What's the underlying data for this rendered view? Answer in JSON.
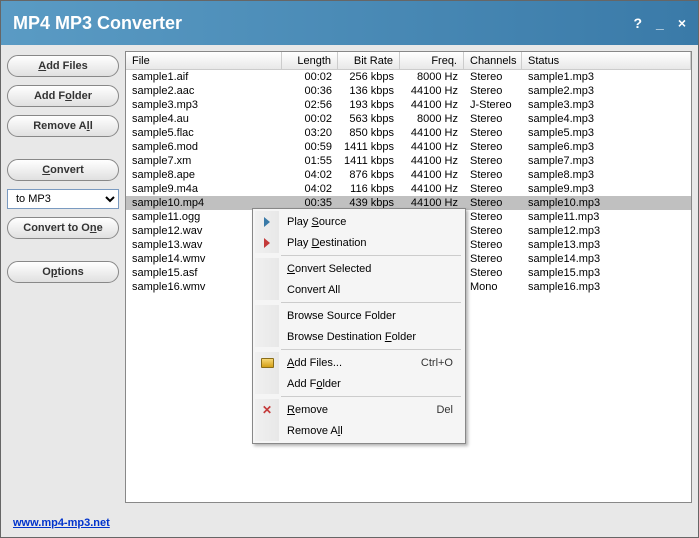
{
  "titlebar": {
    "title": "MP4 MP3 Converter"
  },
  "sidebar": {
    "add_files": "Add Files",
    "add_folder": "Add Folder",
    "remove_all": "Remove All",
    "convert": "Convert",
    "format_selected": "to MP3",
    "convert_to_one": "Convert to One",
    "options": "Options"
  },
  "grid": {
    "headers": {
      "file": "File",
      "length": "Length",
      "bitrate": "Bit Rate",
      "freq": "Freq.",
      "channels": "Channels",
      "status": "Status"
    },
    "rows": [
      {
        "file": "sample1.aif",
        "length": "00:02",
        "bitrate": "256 kbps",
        "freq": "8000 Hz",
        "channels": "Stereo",
        "status": "sample1.mp3"
      },
      {
        "file": "sample2.aac",
        "length": "00:36",
        "bitrate": "136 kbps",
        "freq": "44100 Hz",
        "channels": "Stereo",
        "status": "sample2.mp3"
      },
      {
        "file": "sample3.mp3",
        "length": "02:56",
        "bitrate": "193 kbps",
        "freq": "44100 Hz",
        "channels": "J-Stereo",
        "status": "sample3.mp3"
      },
      {
        "file": "sample4.au",
        "length": "00:02",
        "bitrate": "563 kbps",
        "freq": "8000 Hz",
        "channels": "Stereo",
        "status": "sample4.mp3"
      },
      {
        "file": "sample5.flac",
        "length": "03:20",
        "bitrate": "850 kbps",
        "freq": "44100 Hz",
        "channels": "Stereo",
        "status": "sample5.mp3"
      },
      {
        "file": "sample6.mod",
        "length": "00:59",
        "bitrate": "1411 kbps",
        "freq": "44100 Hz",
        "channels": "Stereo",
        "status": "sample6.mp3"
      },
      {
        "file": "sample7.xm",
        "length": "01:55",
        "bitrate": "1411 kbps",
        "freq": "44100 Hz",
        "channels": "Stereo",
        "status": "sample7.mp3"
      },
      {
        "file": "sample8.ape",
        "length": "04:02",
        "bitrate": "876 kbps",
        "freq": "44100 Hz",
        "channels": "Stereo",
        "status": "sample8.mp3"
      },
      {
        "file": "sample9.m4a",
        "length": "04:02",
        "bitrate": "116 kbps",
        "freq": "44100 Hz",
        "channels": "Stereo",
        "status": "sample9.mp3"
      },
      {
        "file": "sample10.mp4",
        "length": "00:35",
        "bitrate": "439 kbps",
        "freq": "44100 Hz",
        "channels": "Stereo",
        "status": "sample10.mp3",
        "selected": true
      },
      {
        "file": "sample11.ogg",
        "length": "",
        "bitrate": "",
        "freq": "",
        "channels": "Stereo",
        "status": "sample11.mp3"
      },
      {
        "file": "sample12.wav",
        "length": "",
        "bitrate": "",
        "freq": "",
        "channels": "Stereo",
        "status": "sample12.mp3"
      },
      {
        "file": "sample13.wav",
        "length": "",
        "bitrate": "",
        "freq": "",
        "channels": "Stereo",
        "status": "sample13.mp3"
      },
      {
        "file": "sample14.wmv",
        "length": "",
        "bitrate": "",
        "freq": "",
        "channels": "Stereo",
        "status": "sample14.mp3"
      },
      {
        "file": "sample15.asf",
        "length": "",
        "bitrate": "",
        "freq": "",
        "channels": "Stereo",
        "status": "sample15.mp3"
      },
      {
        "file": "sample16.wmv",
        "length": "",
        "bitrate": "",
        "freq": "",
        "channels": "Mono",
        "status": "sample16.mp3"
      }
    ]
  },
  "context_menu": {
    "play_source": "Play Source",
    "play_destination": "Play Destination",
    "convert_selected": "Convert Selected",
    "convert_all": "Convert All",
    "browse_source": "Browse Source Folder",
    "browse_dest": "Browse Destination Folder",
    "add_files": "Add Files...",
    "add_files_shortcut": "Ctrl+O",
    "add_folder": "Add Folder",
    "remove": "Remove",
    "remove_shortcut": "Del",
    "remove_all": "Remove All"
  },
  "footer": {
    "link": "www.mp4-mp3.net"
  }
}
